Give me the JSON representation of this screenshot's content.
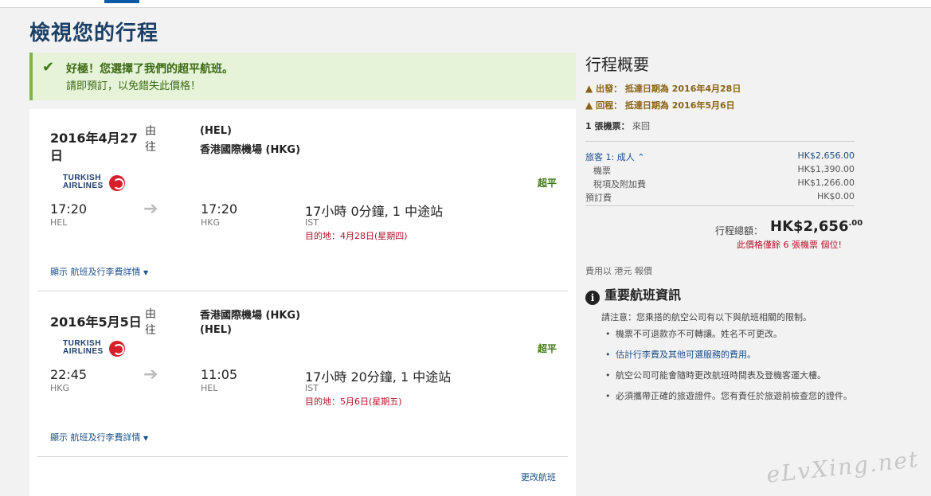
{
  "page": {
    "title": "檢視您的行程"
  },
  "alert": {
    "title": "好極！您選擇了我們的超平航班。",
    "message": "請即預訂，以免錯失此價格！"
  },
  "segments": [
    {
      "date": "2016年4月27日",
      "from_label": "由",
      "to_label": "往",
      "origin_airport": "(HEL)",
      "dest_airport": "香港國際機場 (HKG)",
      "airline_logo_line1": "TURKISH",
      "airline_logo_line2": "AIRLINES",
      "deal_badge": "超平",
      "depart_time": "17:20",
      "depart_code": "HEL",
      "arrive_time": "17:20",
      "arrive_code": "HKG",
      "duration": "17小時 0分鐘, 1 中途站",
      "stopover": "IST",
      "arrival_note": "目的地：4月28日(星期四)",
      "details_link": "顯示 航班及行李費詳情"
    },
    {
      "date": "2016年5月5日",
      "from_label": "由",
      "to_label": "往",
      "origin_airport": "香港國際機場 (HKG)",
      "dest_airport": "(HEL)",
      "airline_logo_line1": "TURKISH",
      "airline_logo_line2": "AIRLINES",
      "deal_badge": "超平",
      "depart_time": "22:45",
      "depart_code": "HKG",
      "arrive_time": "11:05",
      "arrive_code": "HEL",
      "duration": "17小時 20分鐘, 1 中途站",
      "stopover": "IST",
      "arrival_note": "目的地：5月6日(星期五)",
      "details_link": "顯示 航班及行李費詳情"
    }
  ],
  "change_flight_link": "更改航班",
  "summary": {
    "title": "行程概要",
    "depart_warning": "出發： 抵達日期為 2016年4月28日",
    "return_warning": "回程： 抵達日期為 2016年5月6日",
    "tickets_count": "1 張機票：",
    "tickets_type": "來回",
    "traveler_label": "旅客 1: 成人",
    "traveler_price": "HK$2,656.00",
    "fare_label": "機票",
    "fare_price": "HK$1,390.00",
    "tax_label": "稅項及附加費",
    "tax_price": "HK$1,266.00",
    "booking_fee_label": "預訂費",
    "booking_fee_price": "HK$0.00",
    "total_label": "行程總額：",
    "total_main": "HK$2,656",
    "total_cents": ".00",
    "seats_left": "此價格僅餘 6 張機票 個位!",
    "currency_note": "費用以 港元 報價"
  },
  "info": {
    "title": "重要航班資訊",
    "note": "請注意：您乘搭的航空公司有以下與航班相關的限制。",
    "items": [
      "機票不可退款亦不可轉讓。姓名不可更改。",
      "估計行李費及其他可選服務的費用。",
      "航空公司可能會隨時更改航班時間表及登機客運大樓。",
      "必須攜帶正確的旅遊證件。您有責任於旅遊前檢查您的證件。"
    ]
  },
  "watermark": "eLvXing.net",
  "icons": {
    "check": "check-icon",
    "arrow": "arrow-right-icon",
    "warning": "warning-icon",
    "info": "info-icon",
    "chevron": "chevron-down-icon"
  },
  "colors": {
    "title": "#1c3f66",
    "success_bg": "#e6f3d8",
    "success_text": "#3d6b15",
    "link": "#1a4f8a",
    "alert_red": "#b5122a",
    "warning": "#8a6310"
  }
}
